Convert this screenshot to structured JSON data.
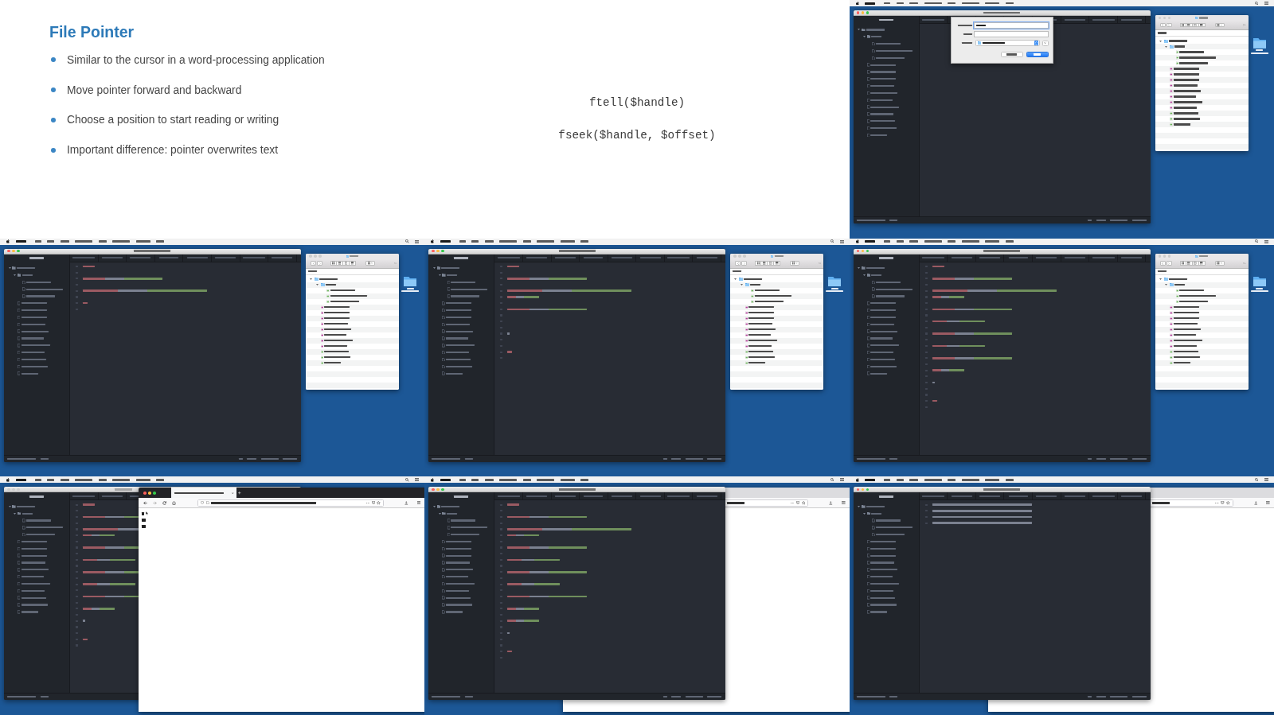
{
  "frames": [
    {
      "kind": "slide",
      "title": "File Pointer",
      "bullets": [
        "Similar to the cursor in a word-processing application",
        "Move pointer forward and backward",
        "Choose a position to start reading or writing",
        "Important difference: pointer overwrites text"
      ]
    },
    {
      "kind": "slide",
      "code": [
        "ftell($handle)",
        "fseek($handle, $offset)"
      ]
    },
    {
      "kind": "screen_recording",
      "desktop_folder": true,
      "windows": [
        {
          "kind": "editor",
          "active": true,
          "dialog": true
        },
        {
          "kind": "finder",
          "active": false
        }
      ]
    },
    {
      "kind": "screen_recording",
      "desktop_folder": true,
      "windows": [
        {
          "kind": "editor",
          "active": true,
          "lines": [
            {
              "kind": "short"
            },
            {
              "kind": "blank"
            },
            {
              "kind": "longer"
            },
            {
              "kind": "blank"
            },
            {
              "kind": "longest"
            },
            {
              "kind": "blank"
            },
            {
              "kind": "tiny"
            },
            {
              "kind": "blank"
            }
          ]
        },
        {
          "kind": "finder",
          "active": false
        }
      ]
    },
    {
      "kind": "screen_recording",
      "desktop_folder": true,
      "windows": [
        {
          "kind": "editor",
          "active": true,
          "lines": [
            {
              "kind": "short"
            },
            {
              "kind": "blank"
            },
            {
              "kind": "longer"
            },
            {
              "kind": "blank"
            },
            {
              "kind": "longest"
            },
            {
              "kind": "medium"
            },
            {
              "kind": "blank"
            },
            {
              "kind": "longer"
            },
            {
              "kind": "blank"
            },
            {
              "kind": "blank"
            },
            {
              "kind": "blank"
            },
            {
              "kind": "dot"
            },
            {
              "kind": "blank"
            },
            {
              "kind": "blank"
            },
            {
              "kind": "tiny"
            },
            {
              "kind": "blank"
            }
          ]
        },
        {
          "kind": "finder",
          "active": false
        }
      ]
    },
    {
      "kind": "screen_recording",
      "desktop_folder": true,
      "windows": [
        {
          "kind": "editor",
          "active": true,
          "lines": [
            {
              "kind": "short"
            },
            {
              "kind": "blank"
            },
            {
              "kind": "longer"
            },
            {
              "kind": "blank"
            },
            {
              "kind": "longest"
            },
            {
              "kind": "medium"
            },
            {
              "kind": "blank"
            },
            {
              "kind": "longer"
            },
            {
              "kind": "blank"
            },
            {
              "kind": "long"
            },
            {
              "kind": "blank"
            },
            {
              "kind": "longer"
            },
            {
              "kind": "blank"
            },
            {
              "kind": "long"
            },
            {
              "kind": "blank"
            },
            {
              "kind": "longer"
            },
            {
              "kind": "blank"
            },
            {
              "kind": "medium"
            },
            {
              "kind": "blank"
            },
            {
              "kind": "dot"
            },
            {
              "kind": "blank"
            },
            {
              "kind": "blank"
            },
            {
              "kind": "tiny"
            },
            {
              "kind": "blank"
            }
          ]
        },
        {
          "kind": "finder",
          "active": false
        }
      ]
    },
    {
      "kind": "screen_recording",
      "windows": [
        {
          "kind": "editor",
          "active": false,
          "lines": [
            {
              "kind": "short"
            },
            {
              "kind": "blank"
            },
            {
              "kind": "longer"
            },
            {
              "kind": "blank"
            },
            {
              "kind": "longest"
            },
            {
              "kind": "medium"
            },
            {
              "kind": "blank"
            },
            {
              "kind": "longer"
            },
            {
              "kind": "blank"
            },
            {
              "kind": "long"
            },
            {
              "kind": "blank"
            },
            {
              "kind": "longer"
            },
            {
              "kind": "blank"
            },
            {
              "kind": "long"
            },
            {
              "kind": "blank"
            },
            {
              "kind": "longer"
            },
            {
              "kind": "blank"
            },
            {
              "kind": "medium"
            },
            {
              "kind": "blank"
            },
            {
              "kind": "dot"
            },
            {
              "kind": "blank"
            },
            {
              "kind": "blank"
            },
            {
              "kind": "tiny"
            },
            {
              "kind": "blank"
            }
          ]
        },
        {
          "kind": "browser",
          "active": true
        }
      ]
    },
    {
      "kind": "screen_recording",
      "windows": [
        {
          "kind": "browser",
          "active": false
        },
        {
          "kind": "editor",
          "active": true,
          "lines": [
            {
              "kind": "short"
            },
            {
              "kind": "blank"
            },
            {
              "kind": "longer"
            },
            {
              "kind": "blank"
            },
            {
              "kind": "longest"
            },
            {
              "kind": "medium"
            },
            {
              "kind": "blank"
            },
            {
              "kind": "longer"
            },
            {
              "kind": "blank"
            },
            {
              "kind": "long"
            },
            {
              "kind": "blank"
            },
            {
              "kind": "longer"
            },
            {
              "kind": "blank"
            },
            {
              "kind": "long"
            },
            {
              "kind": "blank"
            },
            {
              "kind": "longer"
            },
            {
              "kind": "blank"
            },
            {
              "kind": "medium"
            },
            {
              "kind": "blank"
            },
            {
              "kind": "medium"
            },
            {
              "kind": "blank"
            },
            {
              "kind": "dot"
            },
            {
              "kind": "blank"
            },
            {
              "kind": "blank"
            },
            {
              "kind": "tiny"
            },
            {
              "kind": "blank"
            }
          ]
        }
      ]
    },
    {
      "kind": "screen_recording",
      "windows": [
        {
          "kind": "browser",
          "active": false
        },
        {
          "kind": "editor",
          "active": true,
          "lines": [
            {
              "kind": "prose"
            },
            {
              "kind": "prose"
            },
            {
              "kind": "prose"
            },
            {
              "kind": "prose"
            }
          ]
        }
      ]
    }
  ]
}
